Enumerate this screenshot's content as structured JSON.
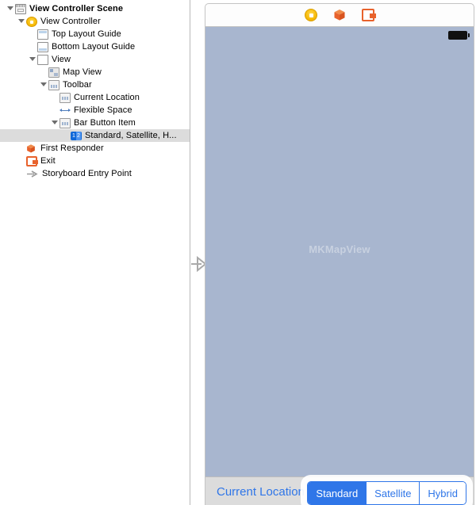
{
  "outline": {
    "rows": [
      {
        "label": "View Controller Scene",
        "icon": "scene-icon",
        "indent": 0,
        "twisty": "open",
        "bold": true,
        "selected": false
      },
      {
        "label": "View Controller",
        "icon": "view-controller-icon",
        "indent": 1,
        "twisty": "open",
        "bold": false,
        "selected": false
      },
      {
        "label": "Top Layout Guide",
        "icon": "top-layout-guide-icon",
        "indent": 2,
        "twisty": "none",
        "bold": false,
        "selected": false
      },
      {
        "label": "Bottom Layout Guide",
        "icon": "bottom-layout-guide-icon",
        "indent": 2,
        "twisty": "none",
        "bold": false,
        "selected": false
      },
      {
        "label": "View",
        "icon": "view-icon",
        "indent": 2,
        "twisty": "open",
        "bold": false,
        "selected": false
      },
      {
        "label": "Map View",
        "icon": "map-view-icon",
        "indent": 3,
        "twisty": "none",
        "bold": false,
        "selected": false
      },
      {
        "label": "Toolbar",
        "icon": "toolbar-icon",
        "indent": 3,
        "twisty": "open",
        "bold": false,
        "selected": false
      },
      {
        "label": "Current Location",
        "icon": "bar-button-item-icon",
        "indent": 4,
        "twisty": "none",
        "bold": false,
        "selected": false
      },
      {
        "label": "Flexible Space",
        "icon": "flexible-space-icon",
        "indent": 4,
        "twisty": "none",
        "bold": false,
        "selected": false
      },
      {
        "label": "Bar Button Item",
        "icon": "bar-button-item-icon",
        "indent": 4,
        "twisty": "open",
        "bold": false,
        "selected": false
      },
      {
        "label": "Standard, Satellite, H...",
        "icon": "segmented-control-icon",
        "indent": 5,
        "twisty": "none",
        "bold": false,
        "selected": true
      },
      {
        "label": "First Responder",
        "icon": "first-responder-icon",
        "indent": 1,
        "twisty": "none",
        "bold": false,
        "selected": false
      },
      {
        "label": "Exit",
        "icon": "exit-icon",
        "indent": 1,
        "twisty": "none",
        "bold": false,
        "selected": false
      },
      {
        "label": "Storyboard Entry Point",
        "icon": "storyboard-entry-point-icon",
        "indent": 1,
        "twisty": "none",
        "bold": false,
        "selected": false
      }
    ]
  },
  "canvas": {
    "scene_bar": {
      "icons": [
        "view-controller-icon",
        "first-responder-icon",
        "exit-icon"
      ]
    },
    "statusbar": {
      "battery": "battery-icon"
    },
    "map": {
      "placeholder_label": "MKMapView",
      "fill_color": "#a8b6cf",
      "label_color": "#c8d1e0"
    },
    "toolbar": {
      "button_label": "Current Location",
      "tint_color": "#2f76e8",
      "segmented_control": {
        "segments": [
          "Standard",
          "Satellite",
          "Hybrid"
        ],
        "selected_index": 0
      }
    }
  }
}
